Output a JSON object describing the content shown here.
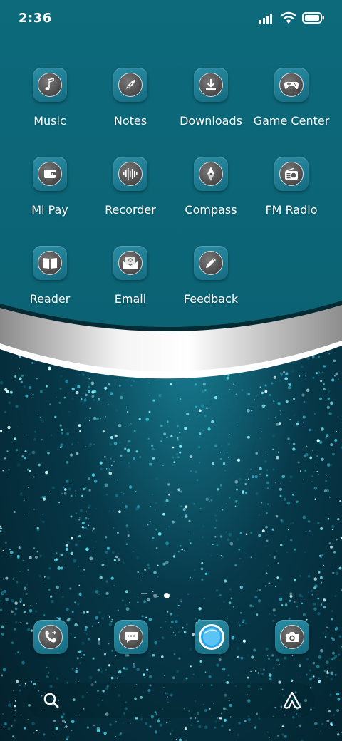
{
  "status_bar": {
    "time": "2:36"
  },
  "apps": [
    {
      "label": "Music",
      "icon": "music-note-icon"
    },
    {
      "label": "Notes",
      "icon": "feather-icon"
    },
    {
      "label": "Downloads",
      "icon": "download-icon"
    },
    {
      "label": "Game Center",
      "icon": "gamepad-icon"
    },
    {
      "label": "Mi Pay",
      "icon": "wallet-icon"
    },
    {
      "label": "Recorder",
      "icon": "waveform-icon"
    },
    {
      "label": "Compass",
      "icon": "compass-icon"
    },
    {
      "label": "FM Radio",
      "icon": "radio-icon"
    },
    {
      "label": "Reader",
      "icon": "book-icon"
    },
    {
      "label": "Email",
      "icon": "email-icon"
    },
    {
      "label": "Feedback",
      "icon": "pencil-icon"
    }
  ],
  "dock": [
    {
      "name": "phone",
      "icon": "phone-icon"
    },
    {
      "name": "messages",
      "icon": "message-icon"
    },
    {
      "name": "browser",
      "icon": "browser-icon"
    },
    {
      "name": "camera",
      "icon": "camera-icon"
    }
  ],
  "page_indicator": {
    "pages": 2,
    "active": 2
  },
  "colors": {
    "panel": "#0b6a7c",
    "icon_bg": "#1d7d93",
    "silver": "#d9d9d9"
  }
}
